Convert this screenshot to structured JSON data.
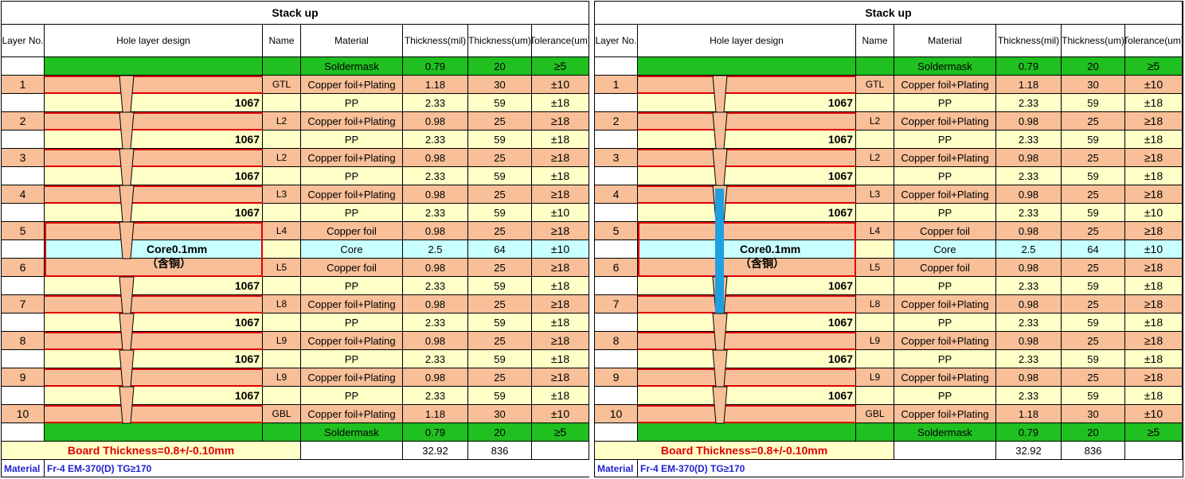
{
  "title": "Stack up",
  "headers": {
    "layer_no": "Layer No.",
    "hole_design": "Hole layer design",
    "name": "Name",
    "material": "Material",
    "thickness_mil": "Thickness\n(mil)",
    "thickness_um": "Thickness\n(um)",
    "tolerance": "Tolerance\n(um)"
  },
  "rows": [
    {
      "layer": "",
      "name": "",
      "material": "Soldermask",
      "mil": "0.79",
      "um": "20",
      "tol": "≥5",
      "color": "green"
    },
    {
      "layer": "1",
      "name": "GTL",
      "material": "Copper foil+Plating",
      "mil": "1.18",
      "um": "30",
      "tol": "±10",
      "color": "peach"
    },
    {
      "layer": "",
      "name": "",
      "material": "PP",
      "mil": "2.33",
      "um": "59",
      "tol": "±18",
      "color": "cream",
      "pp": "1067"
    },
    {
      "layer": "2",
      "name": "L2",
      "material": "Copper foil+Plating",
      "mil": "0.98",
      "um": "25",
      "tol": "≥18",
      "color": "peach"
    },
    {
      "layer": "",
      "name": "",
      "material": "PP",
      "mil": "2.33",
      "um": "59",
      "tol": "±18",
      "color": "cream",
      "pp": "1067"
    },
    {
      "layer": "3",
      "name": "L2",
      "material": "Copper foil+Plating",
      "mil": "0.98",
      "um": "25",
      "tol": "≥18",
      "color": "peach"
    },
    {
      "layer": "",
      "name": "",
      "material": "PP",
      "mil": "2.33",
      "um": "59",
      "tol": "±18",
      "color": "cream",
      "pp": "1067"
    },
    {
      "layer": "4",
      "name": "L3",
      "material": "Copper foil+Plating",
      "mil": "0.98",
      "um": "25",
      "tol": "≥18",
      "color": "peach"
    },
    {
      "layer": "",
      "name": "",
      "material": "PP",
      "mil": "2.33",
      "um": "59",
      "tol": "±10",
      "color": "cream",
      "pp": "1067"
    },
    {
      "layer": "5",
      "name": "L4",
      "material": "Copper foil",
      "mil": "0.98",
      "um": "25",
      "tol": "≥18",
      "color": "peach"
    },
    {
      "layer": "",
      "name": "",
      "material": "Core",
      "mil": "2.5",
      "um": "64",
      "tol": "±10",
      "color": "cyan"
    },
    {
      "layer": "6",
      "name": "L5",
      "material": "Copper foil",
      "mil": "0.98",
      "um": "25",
      "tol": "≥18",
      "color": "peach"
    },
    {
      "layer": "",
      "name": "",
      "material": "PP",
      "mil": "2.33",
      "um": "59",
      "tol": "±18",
      "color": "cream",
      "pp": "1067"
    },
    {
      "layer": "7",
      "name": "L8",
      "material": "Copper foil+Plating",
      "mil": "0.98",
      "um": "25",
      "tol": "≥18",
      "color": "peach"
    },
    {
      "layer": "",
      "name": "",
      "material": "PP",
      "mil": "2.33",
      "um": "59",
      "tol": "±18",
      "color": "cream",
      "pp": "1067"
    },
    {
      "layer": "8",
      "name": "L9",
      "material": "Copper foil+Plating",
      "mil": "0.98",
      "um": "25",
      "tol": "≥18",
      "color": "peach"
    },
    {
      "layer": "",
      "name": "",
      "material": "PP",
      "mil": "2.33",
      "um": "59",
      "tol": "±18",
      "color": "cream",
      "pp": "1067"
    },
    {
      "layer": "9",
      "name": "L9",
      "material": "Copper foil+Plating",
      "mil": "0.98",
      "um": "25",
      "tol": "≥18",
      "color": "peach"
    },
    {
      "layer": "",
      "name": "",
      "material": "PP",
      "mil": "2.33",
      "um": "59",
      "tol": "±18",
      "color": "cream",
      "pp": "1067"
    },
    {
      "layer": "10",
      "name": "GBL",
      "material": "Copper foil+Plating",
      "mil": "1.18",
      "um": "30",
      "tol": "±10",
      "color": "peach"
    },
    {
      "layer": "",
      "name": "",
      "material": "Soldermask",
      "mil": "0.79",
      "um": "20",
      "tol": "≥5",
      "color": "green"
    }
  ],
  "core_label": "Core0.1mm（含铜）",
  "board_thickness": "Board Thickness=0.8+/-0.10mm",
  "totals": {
    "mil": "32.92",
    "um": "836"
  },
  "material_label": "Material",
  "material_value": "Fr-4 EM-370(D)  TG≥170",
  "colors": {
    "soldermask": "#20c020",
    "copper": "#f8bf98",
    "prepreg": "#ffffc8",
    "core": "#c8ffff",
    "outline": "#e00000",
    "via_fill": "#f8bf98",
    "through_hole": "#20a0e0"
  },
  "panels": [
    "left",
    "right"
  ]
}
